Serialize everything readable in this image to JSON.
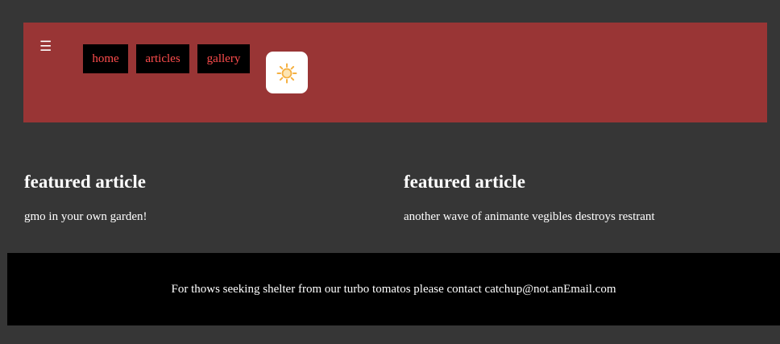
{
  "header": {
    "menu_icon": "hamburger-menu-icon",
    "nav": {
      "home": "home",
      "articles": "articles",
      "gallery": "gallery"
    },
    "theme_toggle_icon": "sun-icon"
  },
  "articles": [
    {
      "title": "featured article",
      "summary": "gmo in your own garden!"
    },
    {
      "title": "featured article",
      "summary": "another wave of animante vegibles destroys restrant"
    }
  ],
  "footer": {
    "text": "For thows seeking shelter from our turbo tomatos please contact catchup@not.anEmail.com"
  },
  "colors": {
    "page_background": "#363636",
    "header_background": "#993535",
    "nav_background": "#000000",
    "nav_text": "#ff4d4d",
    "footer_background": "#000000",
    "sun_icon": "#f5b041"
  }
}
